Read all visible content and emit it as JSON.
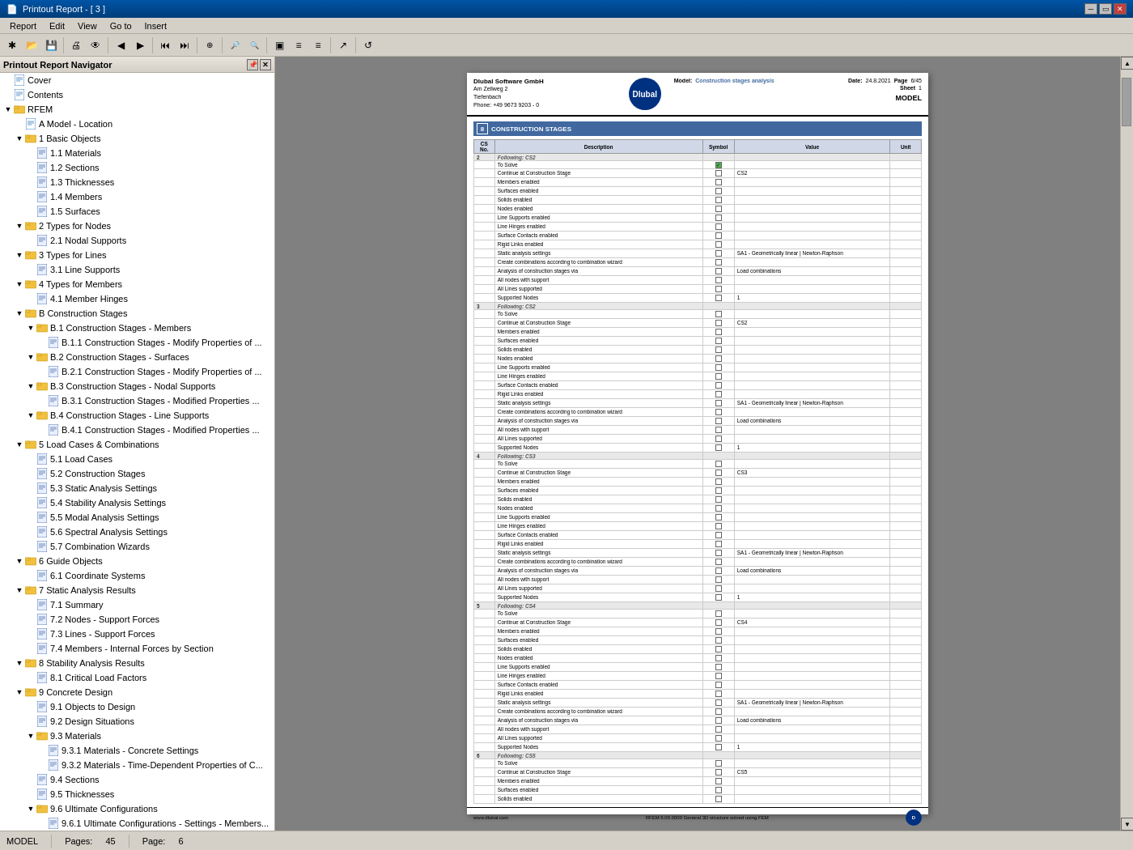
{
  "titlebar": {
    "title": "Printout Report - [ 3 ]",
    "icon": "📄"
  },
  "menubar": {
    "items": [
      "Report",
      "Edit",
      "View",
      "Go to",
      "Insert"
    ]
  },
  "toolbar": {
    "buttons": [
      {
        "name": "new",
        "icon": "✱",
        "tooltip": "New"
      },
      {
        "name": "open",
        "icon": "📂",
        "tooltip": "Open"
      },
      {
        "name": "save",
        "icon": "💾",
        "tooltip": "Save"
      },
      {
        "name": "print",
        "icon": "🖨",
        "tooltip": "Print"
      },
      {
        "name": "preview",
        "icon": "👁",
        "tooltip": "Preview"
      },
      {
        "name": "prev-page",
        "icon": "◀",
        "tooltip": "Previous Page"
      },
      {
        "name": "next-page",
        "icon": "▶",
        "tooltip": "Next Page"
      },
      {
        "name": "first-page",
        "icon": "⏮",
        "tooltip": "First Page"
      },
      {
        "name": "last-page",
        "icon": "⏭",
        "tooltip": "Last Page"
      },
      {
        "name": "move",
        "icon": "⊕",
        "tooltip": "Move"
      },
      {
        "name": "zoom-out",
        "icon": "🔍-",
        "tooltip": "Zoom Out"
      },
      {
        "name": "zoom-in",
        "icon": "🔍+",
        "tooltip": "Zoom In"
      },
      {
        "name": "view1",
        "icon": "▣",
        "tooltip": "View"
      },
      {
        "name": "view2",
        "icon": "≡",
        "tooltip": "View 2"
      },
      {
        "name": "export",
        "icon": "↗",
        "tooltip": "Export"
      },
      {
        "name": "refresh",
        "icon": "↺",
        "tooltip": "Refresh"
      }
    ]
  },
  "navigator": {
    "title": "Printout Report Navigator",
    "items": [
      {
        "id": "cover",
        "label": "Cover",
        "level": 0,
        "type": "page",
        "expanded": false
      },
      {
        "id": "contents",
        "label": "Contents",
        "level": 0,
        "type": "page",
        "expanded": false
      },
      {
        "id": "rfem",
        "label": "RFEM",
        "level": 0,
        "type": "folder",
        "expanded": true
      },
      {
        "id": "a-model",
        "label": "A Model - Location",
        "level": 1,
        "type": "page",
        "expanded": false
      },
      {
        "id": "basic-objects",
        "label": "1 Basic Objects",
        "level": 1,
        "type": "folder",
        "expanded": true
      },
      {
        "id": "1-1",
        "label": "1.1 Materials",
        "level": 2,
        "type": "doc",
        "expanded": false
      },
      {
        "id": "1-2",
        "label": "1.2 Sections",
        "level": 2,
        "type": "doc",
        "expanded": false
      },
      {
        "id": "1-3",
        "label": "1.3 Thicknesses",
        "level": 2,
        "type": "doc",
        "expanded": false
      },
      {
        "id": "1-4",
        "label": "1.4 Members",
        "level": 2,
        "type": "doc",
        "expanded": false
      },
      {
        "id": "1-5",
        "label": "1.5 Surfaces",
        "level": 2,
        "type": "doc",
        "expanded": false
      },
      {
        "id": "2-types-nodes",
        "label": "2 Types for Nodes",
        "level": 1,
        "type": "folder",
        "expanded": true
      },
      {
        "id": "2-1",
        "label": "2.1 Nodal Supports",
        "level": 2,
        "type": "doc",
        "expanded": false
      },
      {
        "id": "3-types-lines",
        "label": "3 Types for Lines",
        "level": 1,
        "type": "folder",
        "expanded": true
      },
      {
        "id": "3-1",
        "label": "3.1 Line Supports",
        "level": 2,
        "type": "doc",
        "expanded": false
      },
      {
        "id": "4-types-members",
        "label": "4 Types for Members",
        "level": 1,
        "type": "folder",
        "expanded": true
      },
      {
        "id": "4-1",
        "label": "4.1 Member Hinges",
        "level": 2,
        "type": "doc",
        "expanded": false
      },
      {
        "id": "b-construction",
        "label": "B Construction Stages",
        "level": 1,
        "type": "folder",
        "expanded": true
      },
      {
        "id": "b1",
        "label": "B.1 Construction Stages - Members",
        "level": 2,
        "type": "folder",
        "expanded": true
      },
      {
        "id": "b1-1",
        "label": "B.1.1 Construction Stages - Modify Properties of ...",
        "level": 3,
        "type": "doc"
      },
      {
        "id": "b2",
        "label": "B.2 Construction Stages - Surfaces",
        "level": 2,
        "type": "folder",
        "expanded": true
      },
      {
        "id": "b2-1",
        "label": "B.2.1 Construction Stages - Modify Properties of ...",
        "level": 3,
        "type": "doc"
      },
      {
        "id": "b3",
        "label": "B.3 Construction Stages - Nodal Supports",
        "level": 2,
        "type": "folder",
        "expanded": true
      },
      {
        "id": "b3-1",
        "label": "B.3.1 Construction Stages - Modified Properties ...",
        "level": 3,
        "type": "doc"
      },
      {
        "id": "b4",
        "label": "B.4 Construction Stages - Line Supports",
        "level": 2,
        "type": "folder",
        "expanded": true
      },
      {
        "id": "b4-1",
        "label": "B.4.1 Construction Stages - Modified Properties ...",
        "level": 3,
        "type": "doc"
      },
      {
        "id": "5-load-cases",
        "label": "5 Load Cases & Combinations",
        "level": 1,
        "type": "folder",
        "expanded": true
      },
      {
        "id": "5-1",
        "label": "5.1 Load Cases",
        "level": 2,
        "type": "doc"
      },
      {
        "id": "5-2",
        "label": "5.2 Construction Stages",
        "level": 2,
        "type": "doc"
      },
      {
        "id": "5-3",
        "label": "5.3 Static Analysis Settings",
        "level": 2,
        "type": "doc"
      },
      {
        "id": "5-4",
        "label": "5.4 Stability Analysis Settings",
        "level": 2,
        "type": "doc"
      },
      {
        "id": "5-5",
        "label": "5.5 Modal Analysis Settings",
        "level": 2,
        "type": "doc"
      },
      {
        "id": "5-6",
        "label": "5.6 Spectral Analysis Settings",
        "level": 2,
        "type": "doc"
      },
      {
        "id": "5-7",
        "label": "5.7 Combination Wizards",
        "level": 2,
        "type": "doc"
      },
      {
        "id": "6-guide",
        "label": "6 Guide Objects",
        "level": 1,
        "type": "folder",
        "expanded": true
      },
      {
        "id": "6-1",
        "label": "6.1 Coordinate Systems",
        "level": 2,
        "type": "doc"
      },
      {
        "id": "7-static",
        "label": "7 Static Analysis Results",
        "level": 1,
        "type": "folder",
        "expanded": true
      },
      {
        "id": "7-1",
        "label": "7.1 Summary",
        "level": 2,
        "type": "doc"
      },
      {
        "id": "7-2",
        "label": "7.2 Nodes - Support Forces",
        "level": 2,
        "type": "doc"
      },
      {
        "id": "7-3",
        "label": "7.3 Lines - Support Forces",
        "level": 2,
        "type": "doc"
      },
      {
        "id": "7-4",
        "label": "7.4 Members - Internal Forces by Section",
        "level": 2,
        "type": "doc"
      },
      {
        "id": "8-stability",
        "label": "8 Stability Analysis Results",
        "level": 1,
        "type": "folder",
        "expanded": true
      },
      {
        "id": "8-1",
        "label": "8.1 Critical Load Factors",
        "level": 2,
        "type": "doc"
      },
      {
        "id": "9-concrete",
        "label": "9 Concrete Design",
        "level": 1,
        "type": "folder",
        "expanded": true
      },
      {
        "id": "9-1",
        "label": "9.1 Objects to Design",
        "level": 2,
        "type": "doc"
      },
      {
        "id": "9-2",
        "label": "9.2 Design Situations",
        "level": 2,
        "type": "doc"
      },
      {
        "id": "9-3",
        "label": "9.3 Materials",
        "level": 2,
        "type": "folder",
        "expanded": true
      },
      {
        "id": "9-3-1",
        "label": "9.3.1 Materials - Concrete Settings",
        "level": 3,
        "type": "doc"
      },
      {
        "id": "9-3-2",
        "label": "9.3.2 Materials - Time-Dependent Properties of C...",
        "level": 3,
        "type": "doc"
      },
      {
        "id": "9-4",
        "label": "9.4 Sections",
        "level": 2,
        "type": "doc"
      },
      {
        "id": "9-5",
        "label": "9.5 Thicknesses",
        "level": 2,
        "type": "doc"
      },
      {
        "id": "9-6",
        "label": "9.6 Ultimate Configurations",
        "level": 2,
        "type": "folder",
        "expanded": true
      },
      {
        "id": "9-6-1",
        "label": "9.6.1 Ultimate Configurations - Settings - Members...",
        "level": 3,
        "type": "doc"
      }
    ]
  },
  "document": {
    "company": {
      "name": "Dlubal Software GmbH",
      "address1": "Am Zellweg 2",
      "address2": "Tiefenbach",
      "phone": "Phone: +49 9673 9203 - 0"
    },
    "model_label": "Model:",
    "model_name": "Construction stages analysis",
    "date_label": "Date:",
    "date_value": "24.8.2021",
    "page_label": "Page",
    "page_value": "6/45",
    "sheet_label": "Sheet",
    "sheet_value": "1",
    "section_title": "CONSTRUCTION STAGES",
    "section_number": "8",
    "title_right": "MODEL",
    "table_headers": [
      "CS No.",
      "Description",
      "Symbol",
      "Value",
      "Unit"
    ],
    "stages": [
      {
        "cs_no": "2",
        "label": "Following: CS2",
        "rows": [
          {
            "desc": "To Solve",
            "checked": true,
            "value": ""
          },
          {
            "desc": "Continue at Construction Stage",
            "checked": false,
            "value": "CS2"
          },
          {
            "desc": "Members enabled",
            "checked": false,
            "value": ""
          },
          {
            "desc": "Surfaces enabled",
            "checked": false,
            "value": ""
          },
          {
            "desc": "Solids enabled",
            "checked": false,
            "value": ""
          },
          {
            "desc": "Nodes enabled",
            "checked": false,
            "value": ""
          },
          {
            "desc": "Line Supports enabled",
            "checked": false,
            "value": ""
          },
          {
            "desc": "Line Hinges enabled",
            "checked": false,
            "value": ""
          },
          {
            "desc": "Surface Contacts enabled",
            "checked": false,
            "value": ""
          },
          {
            "desc": "Rigid Links enabled",
            "checked": false,
            "value": ""
          },
          {
            "desc": "Static analysis settings",
            "checked": false,
            "value": "SA1 - Geometrically linear | Newton-Raphson"
          },
          {
            "desc": "Create combinations according to combination wizard",
            "checked": false,
            "value": ""
          },
          {
            "desc": "Analysis of construction stages via",
            "checked": false,
            "value": "Load combinations"
          },
          {
            "desc": "All nodes with support",
            "checked": false,
            "value": ""
          },
          {
            "desc": "All Lines supported",
            "checked": false,
            "value": ""
          },
          {
            "desc": "Supported Nodes",
            "checked": false,
            "value": "1"
          }
        ]
      },
      {
        "cs_no": "3",
        "label": "Following: CS2",
        "rows": [
          {
            "desc": "To Solve",
            "checked": false,
            "value": ""
          },
          {
            "desc": "Continue at Construction Stage",
            "checked": false,
            "value": "CS2"
          },
          {
            "desc": "Members enabled",
            "checked": false,
            "value": ""
          },
          {
            "desc": "Surfaces enabled",
            "checked": false,
            "value": ""
          },
          {
            "desc": "Solids enabled",
            "checked": false,
            "value": ""
          },
          {
            "desc": "Nodes enabled",
            "checked": false,
            "value": ""
          },
          {
            "desc": "Line Supports enabled",
            "checked": false,
            "value": ""
          },
          {
            "desc": "Line Hinges enabled",
            "checked": false,
            "value": ""
          },
          {
            "desc": "Surface Contacts enabled",
            "checked": false,
            "value": ""
          },
          {
            "desc": "Rigid Links enabled",
            "checked": false,
            "value": ""
          },
          {
            "desc": "Static analysis settings",
            "checked": false,
            "value": "SA1 - Geometrically linear | Newton-Raphson"
          },
          {
            "desc": "Create combinations according to combination wizard",
            "checked": false,
            "value": ""
          },
          {
            "desc": "Analysis of construction stages via",
            "checked": false,
            "value": "Load combinations"
          },
          {
            "desc": "All nodes with support",
            "checked": false,
            "value": ""
          },
          {
            "desc": "All Lines supported",
            "checked": false,
            "value": ""
          },
          {
            "desc": "Supported Nodes",
            "checked": false,
            "value": "1"
          }
        ]
      },
      {
        "cs_no": "4",
        "label": "Following: CS3",
        "rows": [
          {
            "desc": "To Solve",
            "checked": false,
            "value": ""
          },
          {
            "desc": "Continue at Construction Stage",
            "checked": false,
            "value": "CS3"
          },
          {
            "desc": "Members enabled",
            "checked": false,
            "value": ""
          },
          {
            "desc": "Surfaces enabled",
            "checked": false,
            "value": ""
          },
          {
            "desc": "Solids enabled",
            "checked": false,
            "value": ""
          },
          {
            "desc": "Nodes enabled",
            "checked": false,
            "value": ""
          },
          {
            "desc": "Line Supports enabled",
            "checked": false,
            "value": ""
          },
          {
            "desc": "Line Hinges enabled",
            "checked": false,
            "value": ""
          },
          {
            "desc": "Surface Contacts enabled",
            "checked": false,
            "value": ""
          },
          {
            "desc": "Rigid Links enabled",
            "checked": false,
            "value": ""
          },
          {
            "desc": "Static analysis settings",
            "checked": false,
            "value": "SA1 - Geometrically linear | Newton-Raphson"
          },
          {
            "desc": "Create combinations according to combination wizard",
            "checked": false,
            "value": ""
          },
          {
            "desc": "Analysis of construction stages via",
            "checked": false,
            "value": "Load combinations"
          },
          {
            "desc": "All nodes with support",
            "checked": false,
            "value": ""
          },
          {
            "desc": "All Lines supported",
            "checked": false,
            "value": ""
          },
          {
            "desc": "Supported Nodes",
            "checked": false,
            "value": "1"
          }
        ]
      },
      {
        "cs_no": "5",
        "label": "Following: CS4",
        "rows": [
          {
            "desc": "To Solve",
            "checked": false,
            "value": ""
          },
          {
            "desc": "Continue at Construction Stage",
            "checked": false,
            "value": "CS4"
          },
          {
            "desc": "Members enabled",
            "checked": false,
            "value": ""
          },
          {
            "desc": "Surfaces enabled",
            "checked": false,
            "value": ""
          },
          {
            "desc": "Solids enabled",
            "checked": false,
            "value": ""
          },
          {
            "desc": "Nodes enabled",
            "checked": false,
            "value": ""
          },
          {
            "desc": "Line Supports enabled",
            "checked": false,
            "value": ""
          },
          {
            "desc": "Line Hinges enabled",
            "checked": false,
            "value": ""
          },
          {
            "desc": "Surface Contacts enabled",
            "checked": false,
            "value": ""
          },
          {
            "desc": "Rigid Links enabled",
            "checked": false,
            "value": ""
          },
          {
            "desc": "Static analysis settings",
            "checked": false,
            "value": "SA1 - Geometrically linear | Newton-Raphson"
          },
          {
            "desc": "Create combinations according to combination wizard",
            "checked": false,
            "value": ""
          },
          {
            "desc": "Analysis of construction stages via",
            "checked": false,
            "value": "Load combinations"
          },
          {
            "desc": "All nodes with support",
            "checked": false,
            "value": ""
          },
          {
            "desc": "All Lines supported",
            "checked": false,
            "value": ""
          },
          {
            "desc": "Supported Nodes",
            "checked": false,
            "value": "1"
          }
        ]
      },
      {
        "cs_no": "6",
        "label": "Following: CS5",
        "rows": [
          {
            "desc": "To Solve",
            "checked": false,
            "value": ""
          },
          {
            "desc": "Continue at Construction Stage",
            "checked": false,
            "value": "CS5"
          },
          {
            "desc": "Members enabled",
            "checked": false,
            "value": ""
          },
          {
            "desc": "Surfaces enabled",
            "checked": false,
            "value": ""
          },
          {
            "desc": "Solids enabled",
            "checked": false,
            "value": ""
          }
        ]
      }
    ],
    "footer_url": "www.dlubal.com",
    "footer_software": "RFEM 6.00.0000   General 3D structure solved using FEM"
  },
  "statusbar": {
    "section": "MODEL",
    "pages_label": "Pages:",
    "pages_value": "45",
    "page_label": "Page:",
    "page_value": "6"
  }
}
